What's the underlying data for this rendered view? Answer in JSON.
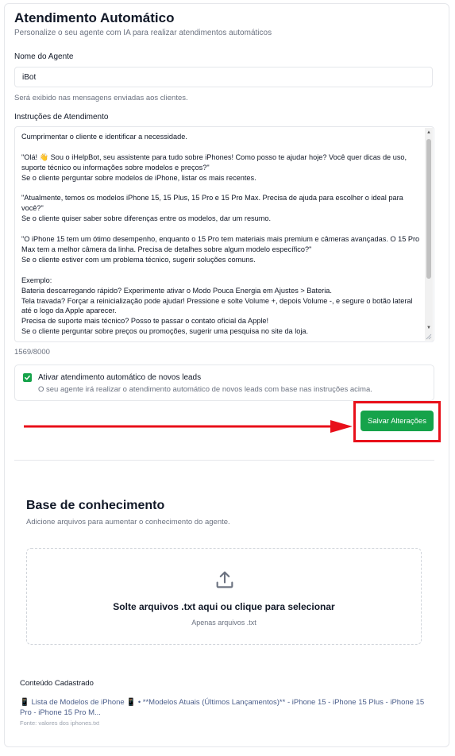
{
  "header": {
    "title": "Atendimento Automático",
    "subtitle": "Personalize o seu agente com IA para realizar atendimentos automáticos"
  },
  "agent": {
    "name_label": "Nome do Agente",
    "name_value": "iBot",
    "name_hint": "Será exibido nas mensagens enviadas aos clientes."
  },
  "instructions": {
    "label": "Instruções de Atendimento",
    "text": "Cumprimentar o cliente e identificar a necessidade.\n\n\"Olá! 👋 Sou o iHelpBot, seu assistente para tudo sobre iPhones! Como posso te ajudar hoje? Você quer dicas de uso, suporte técnico ou informações sobre modelos e preços?\"\nSe o cliente perguntar sobre modelos de iPhone, listar os mais recentes.\n\n\"Atualmente, temos os modelos iPhone 15, 15 Plus, 15 Pro e 15 Pro Max. Precisa de ajuda para escolher o ideal para você?\"\nSe o cliente quiser saber sobre diferenças entre os modelos, dar um resumo.\n\n\"O iPhone 15 tem um ótimo desempenho, enquanto o 15 Pro tem materiais mais premium e câmeras avançadas. O 15 Pro Max tem a melhor câmera da linha. Precisa de detalhes sobre algum modelo específico?\"\nSe o cliente estiver com um problema técnico, sugerir soluções comuns.\n\nExemplo:\nBateria descarregando rápido? Experimente ativar o Modo Pouca Energia em Ajustes > Bateria.\nTela travada? Forçar a reinicialização pode ajudar! Pressione e solte Volume +, depois Volume -, e segure o botão lateral até o logo da Apple aparecer.\nPrecisa de suporte mais técnico? Posso te passar o contato oficial da Apple!\nSe o cliente perguntar sobre preços ou promoções, sugerir uma pesquisa no site da loja.",
    "char_count": "1569/8000"
  },
  "auto_leads": {
    "checked": true,
    "title": "Ativar atendimento automático de novos leads",
    "description": "O seu agente irá realizar o atendimento automático de novos leads com base nas instruções acima."
  },
  "save_button_label": "Salvar Alterações",
  "knowledge_base": {
    "title": "Base de conhecimento",
    "subtitle": "Adicione arquivos para aumentar o conhecimento do agente.",
    "drop_title": "Solte arquivos .txt aqui ou clique para selecionar",
    "drop_sub": "Apenas arquivos .txt",
    "content_label": "Conteúdo Cadastrado",
    "item_text": "📱 Lista de Modelos de iPhone 📱  •  **Modelos Atuais (Últimos Lançamentos)** - iPhone 15 - iPhone 15 Plus - iPhone 15 Pro - iPhone 15 Pro M...",
    "item_source": "Fonte: valores dos iphones.txt"
  },
  "colors": {
    "accent_green": "#16a34a",
    "highlight_red": "#e8101a"
  },
  "icons": [
    "check-icon",
    "upload-icon",
    "arrow-right-icon"
  ]
}
